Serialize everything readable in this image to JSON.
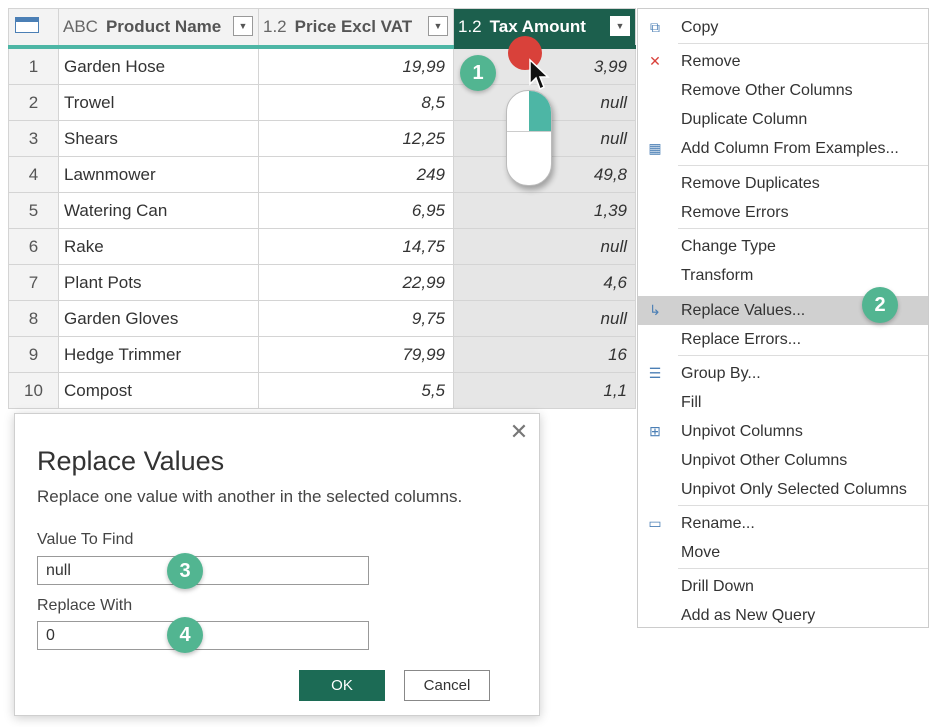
{
  "table": {
    "headers": [
      {
        "type": "ABC",
        "label": "Product Name"
      },
      {
        "type": "1.2",
        "label": "Price Excl VAT"
      },
      {
        "type": "1.2",
        "label": "Tax Amount"
      }
    ],
    "rows": [
      {
        "n": "1",
        "name": "Garden Hose",
        "price": "19,99",
        "tax": "3,99"
      },
      {
        "n": "2",
        "name": "Trowel",
        "price": "8,5",
        "tax": "null"
      },
      {
        "n": "3",
        "name": "Shears",
        "price": "12,25",
        "tax": "null"
      },
      {
        "n": "4",
        "name": "Lawnmower",
        "price": "249",
        "tax": "49,8"
      },
      {
        "n": "5",
        "name": "Watering Can",
        "price": "6,95",
        "tax": "1,39"
      },
      {
        "n": "6",
        "name": "Rake",
        "price": "14,75",
        "tax": "null"
      },
      {
        "n": "7",
        "name": "Plant Pots",
        "price": "22,99",
        "tax": "4,6"
      },
      {
        "n": "8",
        "name": "Garden Gloves",
        "price": "9,75",
        "tax": "null"
      },
      {
        "n": "9",
        "name": "Hedge Trimmer",
        "price": "79,99",
        "tax": "16"
      },
      {
        "n": "10",
        "name": "Compost",
        "price": "5,5",
        "tax": "1,1"
      }
    ]
  },
  "menu": {
    "items": [
      {
        "label": "Copy",
        "icon": "copy-icon"
      },
      {
        "label": "Remove",
        "icon": "remove-icon"
      },
      {
        "label": "Remove Other Columns"
      },
      {
        "label": "Duplicate Column"
      },
      {
        "label": "Add Column From Examples...",
        "icon": "add-column-icon"
      },
      {
        "label": "Remove Duplicates"
      },
      {
        "label": "Remove Errors"
      },
      {
        "label": "Change Type"
      },
      {
        "label": "Transform"
      },
      {
        "label": "Replace Values...",
        "icon": "replace-icon"
      },
      {
        "label": "Replace Errors..."
      },
      {
        "label": "Group By...",
        "icon": "group-by-icon"
      },
      {
        "label": "Fill"
      },
      {
        "label": "Unpivot Columns",
        "icon": "unpivot-icon"
      },
      {
        "label": "Unpivot Other Columns"
      },
      {
        "label": "Unpivot Only Selected Columns"
      },
      {
        "label": "Rename...",
        "icon": "rename-icon"
      },
      {
        "label": "Move"
      },
      {
        "label": "Drill Down"
      },
      {
        "label": "Add as New Query"
      }
    ]
  },
  "badges": {
    "b1": "1",
    "b2": "2",
    "b3": "3",
    "b4": "4"
  },
  "dialog": {
    "title": "Replace Values",
    "description": "Replace one value with another in the selected columns.",
    "find_label": "Value To Find",
    "find_value": "null",
    "replace_label": "Replace With",
    "replace_value": "0",
    "ok": "OK",
    "cancel": "Cancel"
  },
  "colors": {
    "accent": "#1c5f4d",
    "badge": "#52b591",
    "highlight": "#d0d0d0",
    "dot": "#d9413a"
  }
}
